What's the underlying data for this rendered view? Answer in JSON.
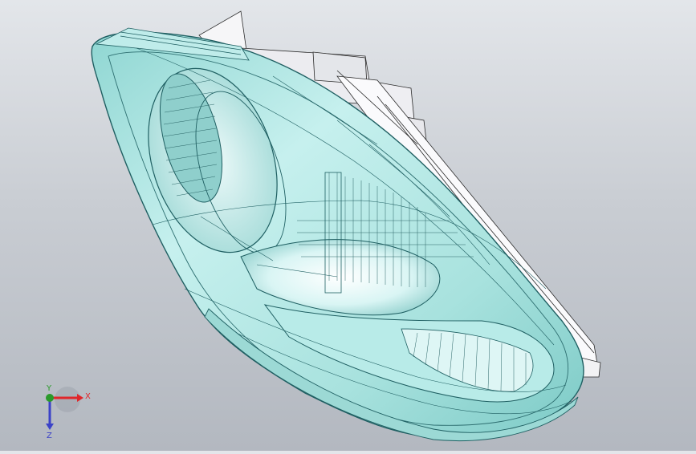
{
  "viewport": {
    "model": "headlamp-assembly",
    "display_style": "shaded-with-edges",
    "colors": {
      "background_top": "#e3e6ea",
      "background_bottom": "#b3b8c0",
      "lens": "#a9e3df",
      "lens_edge": "#1f5f62",
      "housing": "#f4f4f6",
      "reflector": "#c8eef0"
    }
  },
  "triad": {
    "x_label": "X",
    "y_label": "Y",
    "z_label": "Z",
    "x_color": "#e0262a",
    "y_color": "#2a9a2a",
    "z_color": "#3b42c8"
  }
}
